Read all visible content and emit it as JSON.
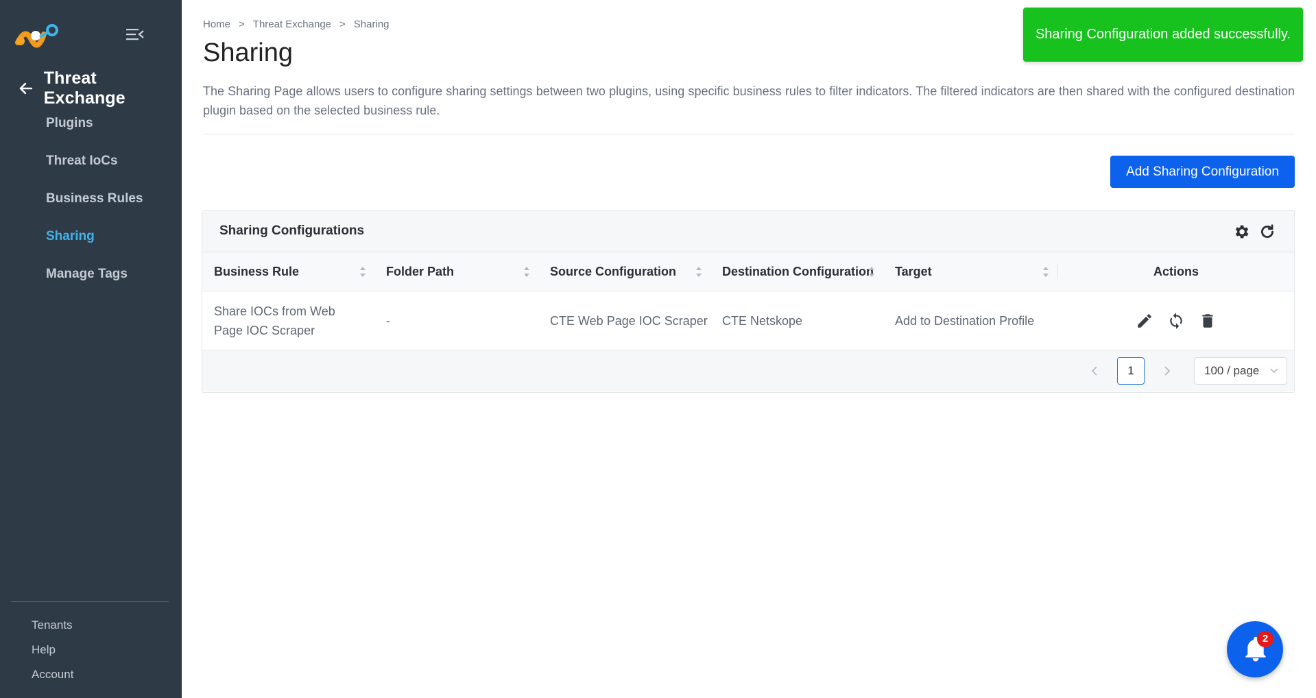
{
  "sidebar": {
    "section_title": "Threat Exchange",
    "items": [
      {
        "label": "Plugins"
      },
      {
        "label": "Threat IoCs"
      },
      {
        "label": "Business Rules"
      },
      {
        "label": "Sharing"
      },
      {
        "label": "Manage Tags"
      }
    ],
    "active_item": "Sharing",
    "bottom_items": [
      {
        "label": "Tenants"
      },
      {
        "label": "Help"
      },
      {
        "label": "Account"
      }
    ]
  },
  "breadcrumb": [
    "Home",
    "Threat Exchange",
    "Sharing"
  ],
  "breadcrumb_separator": ">",
  "page": {
    "title": "Sharing",
    "description": "The Sharing Page allows users to configure sharing settings between two plugins, using specific business rules to filter indicators. The filtered indicators are then shared with the configured destination plugin based on the selected business rule.",
    "add_button": "Add Sharing Configuration"
  },
  "card": {
    "title": "Sharing Configurations",
    "columns": [
      "Business Rule",
      "Folder Path",
      "Source Configuration",
      "Destination Configuration",
      "Target",
      "Actions"
    ],
    "rows": [
      {
        "business_rule": "Share IOCs from Web Page IOC Scraper",
        "folder_path": "-",
        "source": "CTE Web Page IOC Scraper",
        "destination": "CTE Netskope",
        "target": "Add to Destination Profile"
      }
    ],
    "pagination": {
      "current_page": "1",
      "page_size": "100 / page"
    }
  },
  "toast": {
    "message": "Sharing Configuration added successfully.",
    "color": "#17c21f"
  },
  "notifications": {
    "count": "2"
  },
  "colors": {
    "sidebar_bg": "#2f3a47",
    "active_nav": "#3fb4ea",
    "primary": "#0c62ec"
  }
}
